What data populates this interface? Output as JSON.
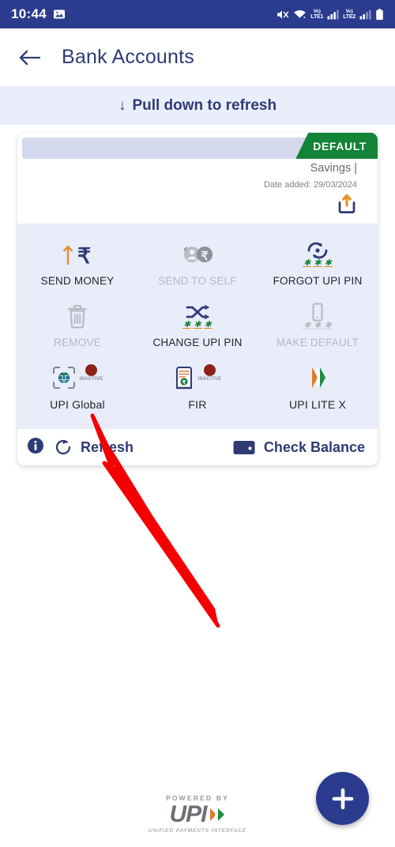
{
  "status_bar": {
    "time": "10:44",
    "left_icons": [
      "image-icon"
    ],
    "right_icons": [
      "mute-icon",
      "wifi-icon",
      "volte-lte1-icon",
      "signal-bars-1-icon",
      "volte-lte2-icon",
      "signal-bars-2-icon",
      "battery-icon"
    ],
    "volte_label": "Vo)",
    "sim1_label": "LTE1",
    "sim2_label": "LTE2",
    "background": "#2b3c8e"
  },
  "app_bar": {
    "back_icon": "arrow-left-icon",
    "title": "Bank Accounts"
  },
  "pull_refresh": {
    "arrow": "↓",
    "label": "Pull down to refresh"
  },
  "account_card": {
    "bank_name": "",
    "badge": "DEFAULT",
    "badge_color": "#138337",
    "account_type": "Savings |",
    "date_added": "Date added: 29/03/2024",
    "share_icon": "share-upload-icon",
    "actions": [
      [
        {
          "label": "SEND MONEY",
          "icon": "send-money-rupee-icon",
          "enabled": true,
          "badge": null
        },
        {
          "label": "SEND TO SELF",
          "icon": "send-to-self-icon",
          "enabled": false,
          "badge": null
        },
        {
          "label": "FORGOT UPI PIN",
          "icon": "forgot-upi-pin-icon",
          "enabled": true,
          "badge": null
        }
      ],
      [
        {
          "label": "REMOVE",
          "icon": "trash-icon",
          "enabled": false,
          "badge": null
        },
        {
          "label": "CHANGE UPI PIN",
          "icon": "change-upi-pin-icon",
          "enabled": true,
          "badge": null
        },
        {
          "label": "MAKE DEFAULT",
          "icon": "make-default-phone-icon",
          "enabled": false,
          "badge": null
        }
      ],
      [
        {
          "label": "UPI Global",
          "icon": "upi-global-icon",
          "enabled": true,
          "badge": "INACTIVE"
        },
        {
          "label": "FIR",
          "icon": "fir-document-icon",
          "enabled": true,
          "badge": "INACTIVE"
        },
        {
          "label": "UPI LITE X",
          "icon": "upi-lite-x-icon",
          "enabled": true,
          "badge": null
        }
      ]
    ],
    "footer": {
      "info_icon": "info-icon",
      "refresh_icon": "refresh-icon",
      "refresh_label": "Refresh",
      "balance_icon": "wallet-icon",
      "balance_label": "Check Balance"
    }
  },
  "powered_by": {
    "top": "POWERED BY",
    "wordmark": "UPI",
    "bottom": "UNIFIED PAYMENTS INTERFACE"
  },
  "fab": {
    "icon": "plus-icon",
    "color": "#2b3c8e"
  },
  "annotation": {
    "type": "arrow",
    "color": "#f50000",
    "points_to": "UPI Global"
  }
}
